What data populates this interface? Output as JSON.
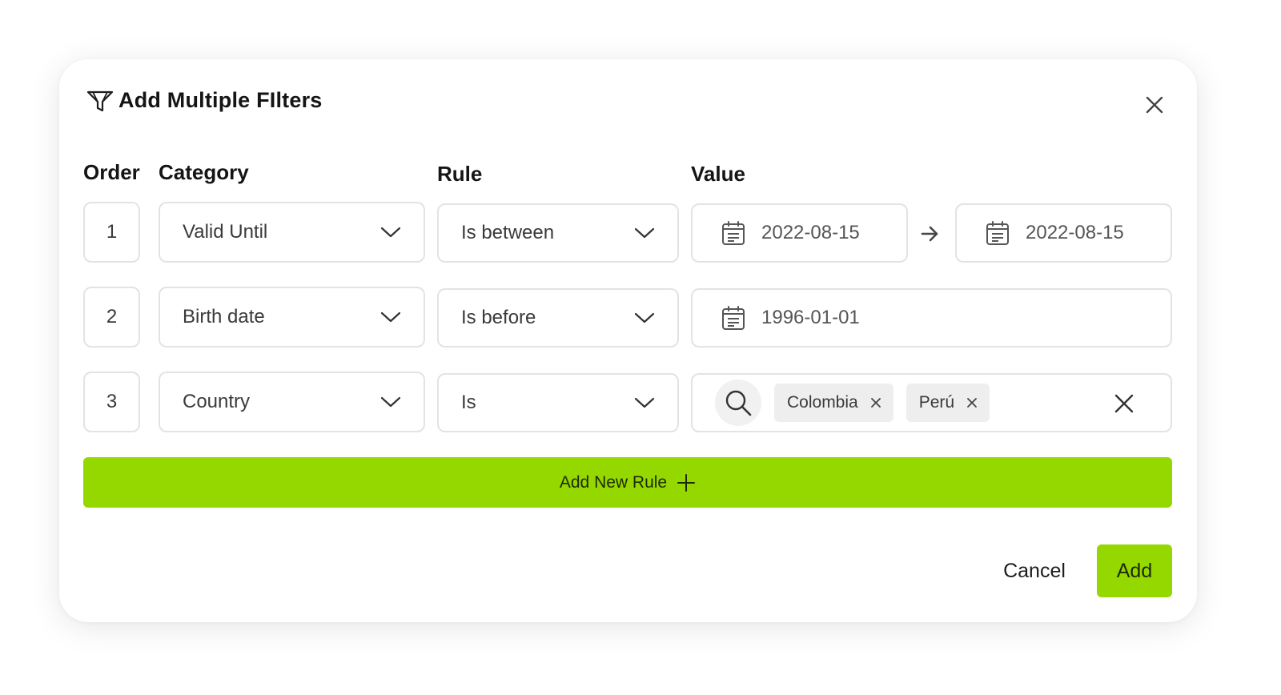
{
  "dialog": {
    "title": "Add Multiple FIlters",
    "icons": {
      "title": "filter-icon",
      "close": "close-icon"
    }
  },
  "columns": {
    "order": "Order",
    "category": "Category",
    "rule": "Rule",
    "value": "Value"
  },
  "rules": [
    {
      "order": "1",
      "category": "Valid Until",
      "rule": "Is between",
      "value_from": "2022-08-15",
      "value_to": "2022-08-15"
    },
    {
      "order": "2",
      "category": "Birth date",
      "rule": "Is before",
      "value": "1996-01-01"
    },
    {
      "order": "3",
      "category": "Country",
      "rule": "Is",
      "tags": [
        "Colombia",
        "Perú"
      ]
    }
  ],
  "add_rule_label": "Add New Rule",
  "footer": {
    "cancel": "Cancel",
    "add": "Add"
  },
  "colors": {
    "accent": "#94d800",
    "border": "#e3e3e3",
    "chip_bg": "#eeeeee"
  }
}
